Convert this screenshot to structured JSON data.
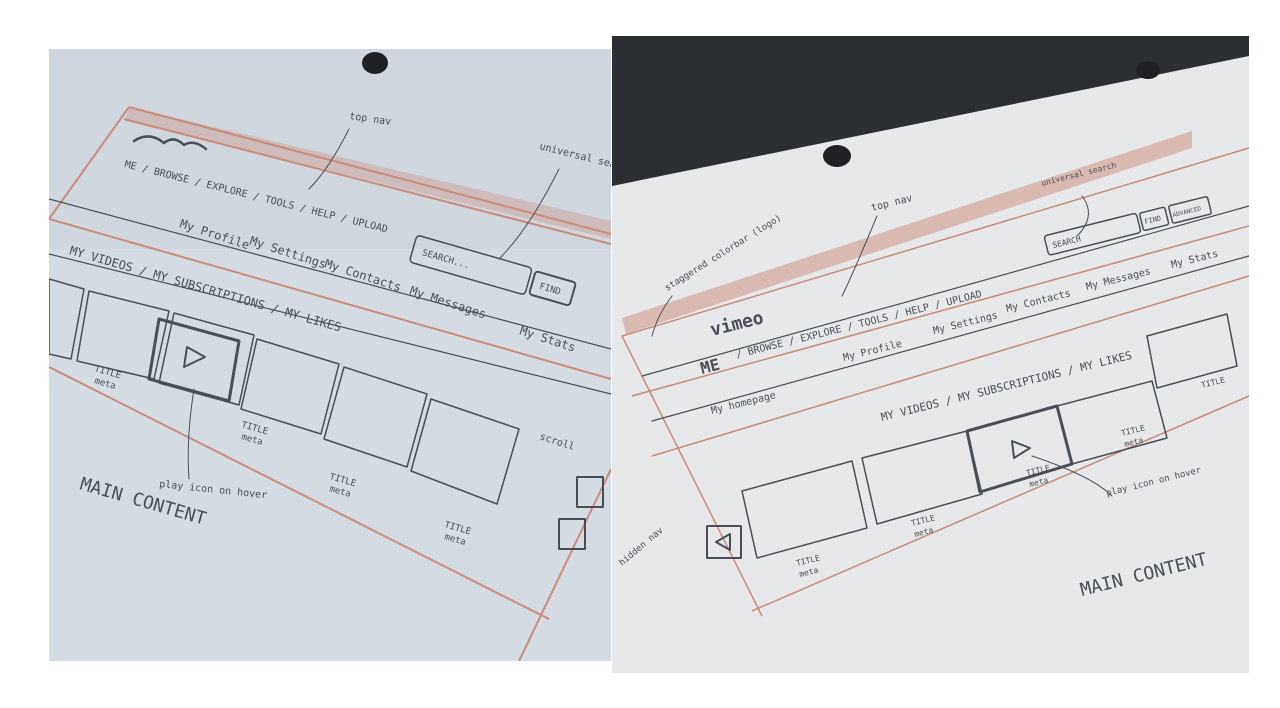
{
  "left_sketch": {
    "nav_primary": "ME / BROWSE / EXPLORE / TOOLS / HELP / UPLOAD",
    "sub_nav": [
      "My Profile",
      "My Settings",
      "My Contacts",
      "My Messages",
      "My Stats"
    ],
    "search": {
      "placeholder": "SEARCH...",
      "button": "FIND"
    },
    "tabs": "MY VIDEOS / MY SUBSCRIPTIONS / MY LIKES",
    "thumb_caption": [
      "TITLE",
      "meta"
    ],
    "annotations": {
      "top_nav": "top nav",
      "search": "universal search",
      "play_icon": "play icon on hover",
      "scroll": "scroll"
    },
    "main_content": "MAIN CONTENT"
  },
  "right_sketch": {
    "logo": "vimeo",
    "me": "ME",
    "nav_primary": "/ BROWSE / EXPLORE / TOOLS / HELP / UPLOAD",
    "sub_nav": [
      "My homepage",
      "My Profile",
      "My Settings",
      "My Contacts",
      "My Messages",
      "My Stats"
    ],
    "search": {
      "placeholder": "SEARCH",
      "button": "FIND",
      "extra_button": "ADVANCED"
    },
    "tabs": "MY VIDEOS / MY SUBSCRIPTIONS / MY LIKES",
    "thumb_caption": [
      "TITLE",
      "meta"
    ],
    "annotations": {
      "top_nav": "top nav",
      "colorbar": "staggered colorbar (logo)",
      "search": "universal search",
      "play_icon": "play icon on hover",
      "hidden_nav": "hidden nav"
    },
    "main_content": "MAIN CONTENT"
  },
  "colors": {
    "paper_left": "#d4dbe3",
    "paper_right": "#e6e8ea",
    "backdrop": "#2b2e33",
    "pencil": "#4a4f57",
    "red_pencil": "#c98c7a"
  }
}
